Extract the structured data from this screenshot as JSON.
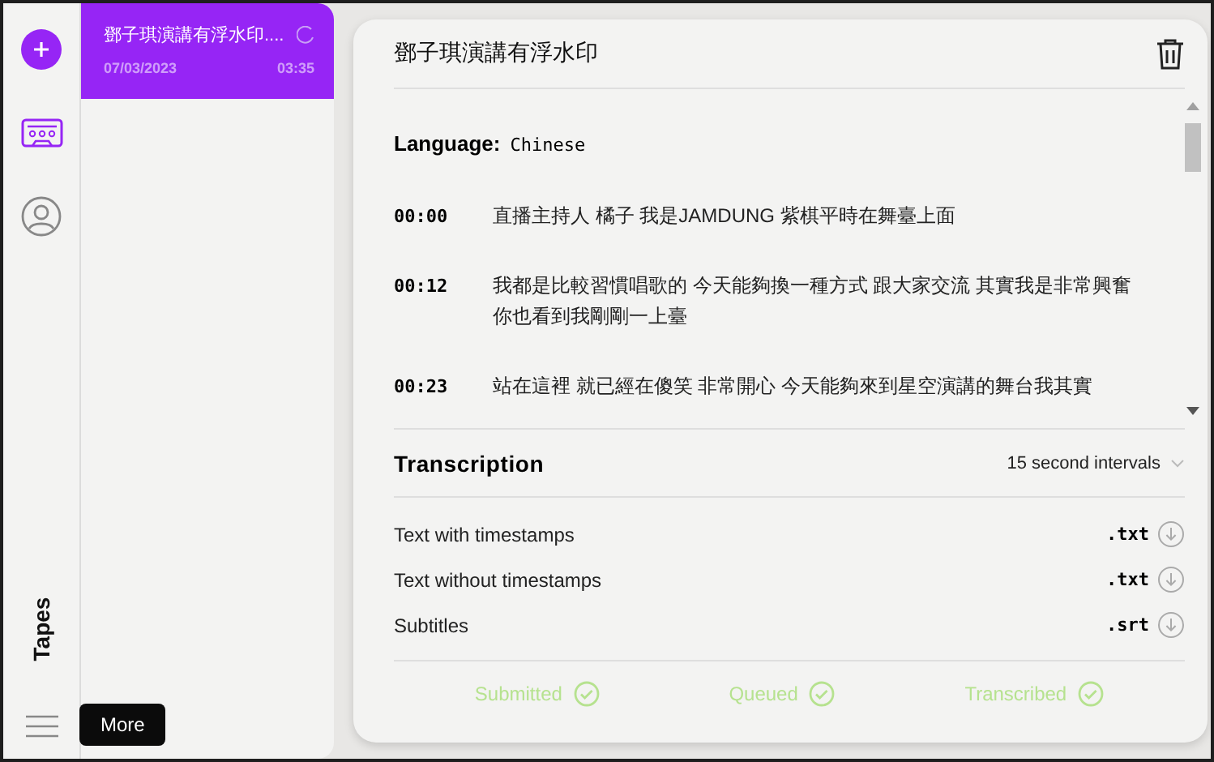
{
  "rail": {
    "tooltip": "More",
    "section_label": "Tapes"
  },
  "tapes": [
    {
      "title": "鄧子琪演講有浮水印....",
      "date": "07/03/2023",
      "duration": "03:35",
      "selected": true,
      "loading": true
    }
  ],
  "detail": {
    "title": "鄧子琪演講有浮水印",
    "language_label": "Language:",
    "language": "Chinese",
    "segments": [
      {
        "time": "00:00",
        "text": "直播主持人 橘子 我是JAMDUNG 紫棋平時在舞臺上面"
      },
      {
        "time": "00:12",
        "text": "我都是比較習慣唱歌的 今天能夠換一種方式 跟大家交流 其實我是非常興奮你也看到我剛剛一上臺"
      },
      {
        "time": "00:23",
        "text": "站在這裡 就已經在傻笑 非常開心 今天能夠來到星空演講的舞台我其實"
      }
    ],
    "transcription": {
      "heading": "Transcription",
      "interval": "15 second intervals",
      "downloads": [
        {
          "label": "Text with timestamps",
          "format": ".txt"
        },
        {
          "label": "Text without timestamps",
          "format": ".txt"
        },
        {
          "label": "Subtitles",
          "format": ".srt"
        }
      ]
    },
    "statuses": [
      {
        "label": "Submitted",
        "done": true
      },
      {
        "label": "Queued",
        "done": true
      },
      {
        "label": "Transcribed",
        "done": true
      }
    ]
  }
}
